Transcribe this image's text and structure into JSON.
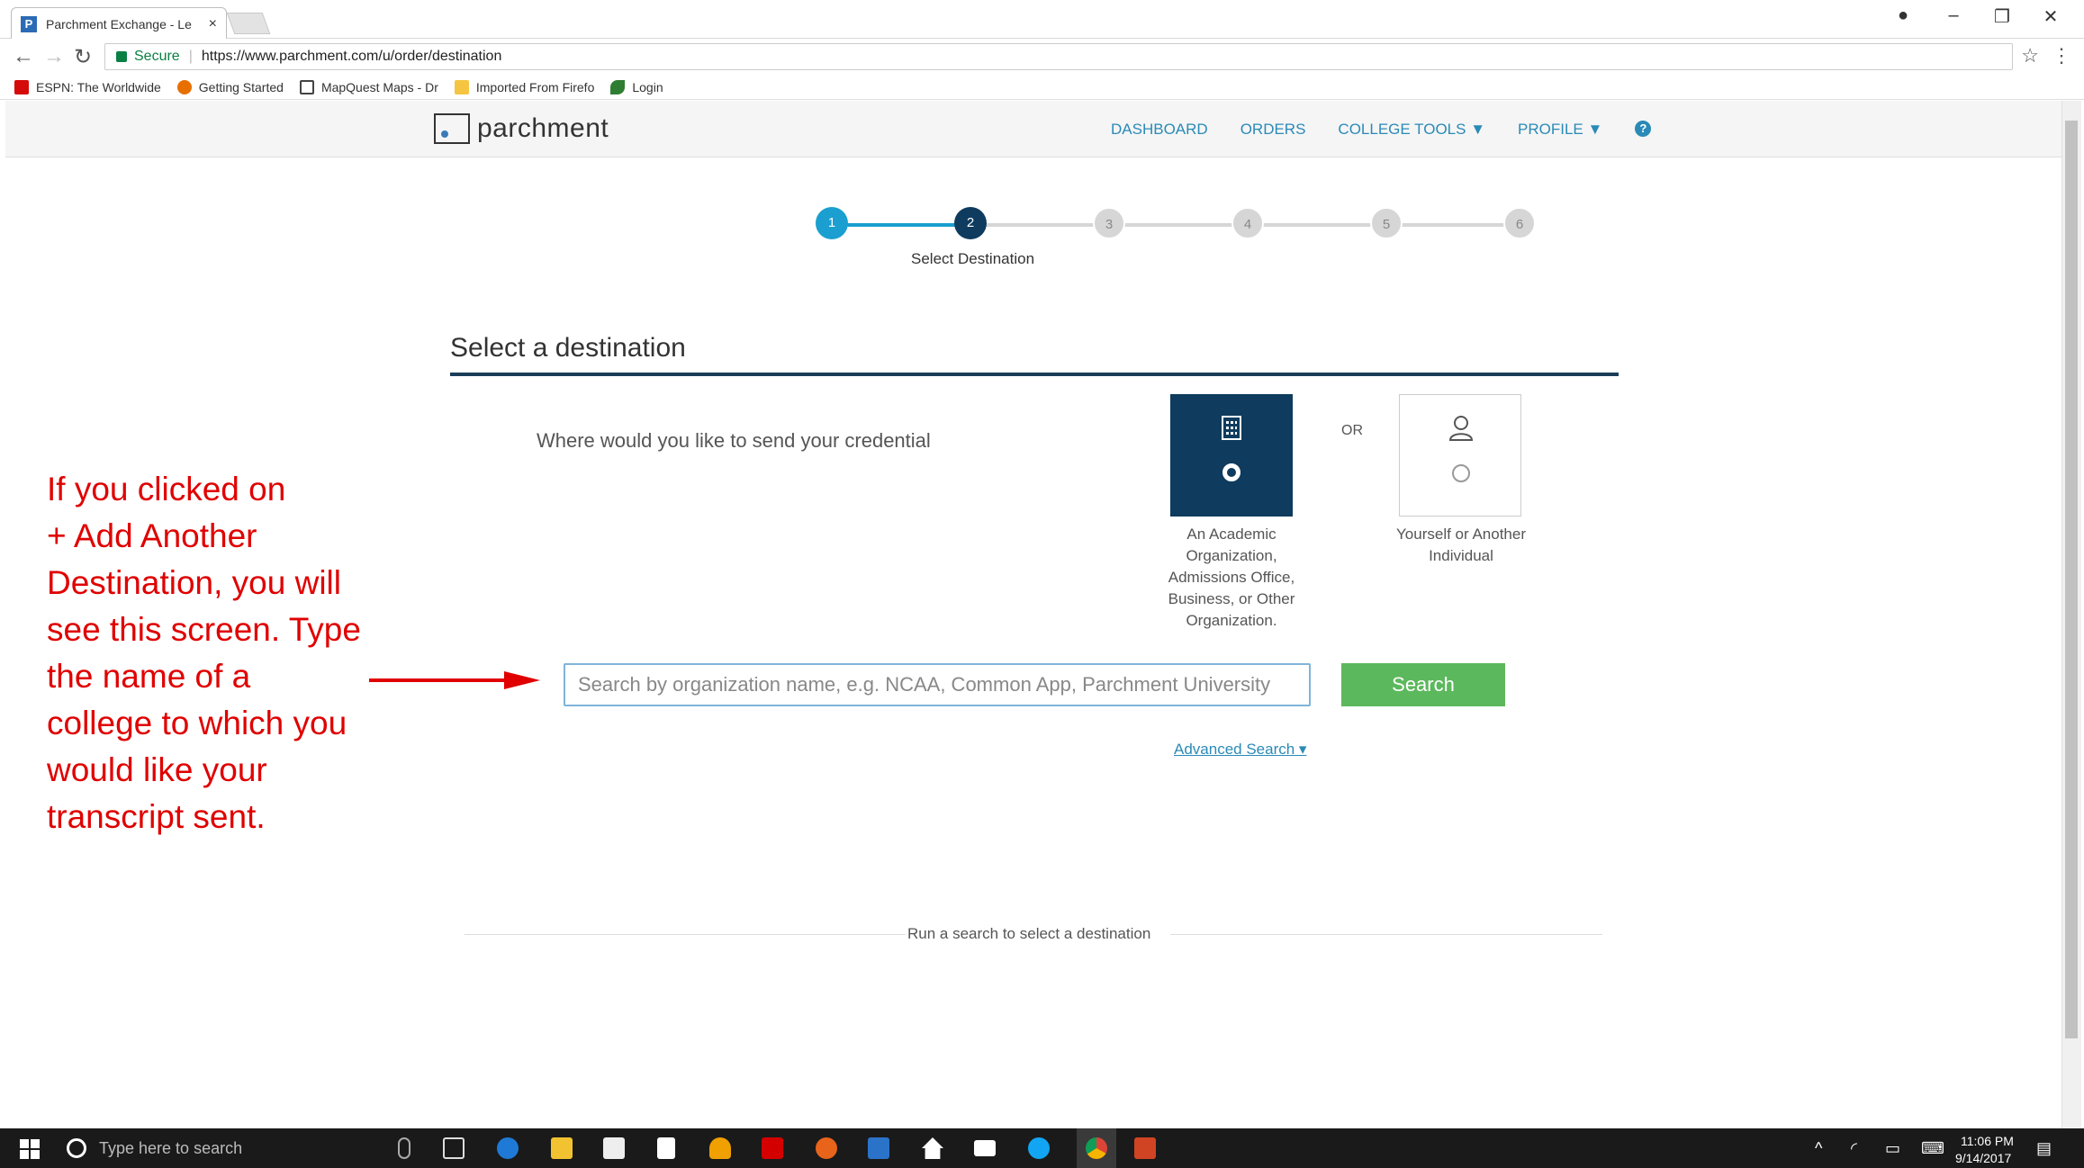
{
  "browser": {
    "tab_title": "Parchment Exchange - Le",
    "tab_close": "×",
    "secure_label": "Secure",
    "url": "https://www.parchment.com/u/order/destination",
    "bookmarks": [
      {
        "label": "ESPN: The Worldwide",
        "color": "#d50a0a"
      },
      {
        "label": "Getting Started",
        "color": "#e76f00"
      },
      {
        "label": "MapQuest Maps - Dr",
        "color": "#444444"
      },
      {
        "label": "Imported From Firefo",
        "color": "#f5c542"
      },
      {
        "label": "Login",
        "color": "#2f7d32"
      }
    ]
  },
  "header": {
    "logo_text": "parchment",
    "nav": {
      "dashboard": "DASHBOARD",
      "orders": "ORDERS",
      "college_tools": "COLLEGE TOOLS ▼",
      "profile": "PROFILE ▼",
      "help": "?"
    }
  },
  "stepper": {
    "steps": [
      "1",
      "2",
      "3",
      "4",
      "5",
      "6"
    ],
    "current_step": 2,
    "caption": "Select Destination",
    "colors": {
      "done": "#1a9fd0",
      "current": "#0e3b5e",
      "pending": "#d6d6d6"
    }
  },
  "main": {
    "section_title": "Select a destination",
    "question": "Where would you like to send your credential",
    "or_label": "OR",
    "choice_org": {
      "caption": "An Academic Organization, Admissions Office, Business, or Other Organization.",
      "selected": true
    },
    "choice_ind": {
      "caption": "Yourself or Another Individual",
      "selected": false
    },
    "search_placeholder": "Search by organization name, e.g. NCAA, Common App, Parchment University",
    "search_button": "Search",
    "advanced_search": "Advanced Search ▾",
    "results_text": "Run a search to select a destination"
  },
  "annotation": {
    "lines": [
      "If you clicked on",
      "+ Add Another",
      "Destination, you will",
      "see this screen. Type",
      "the name of a",
      "college to which you",
      "would like your",
      "transcript sent."
    ],
    "color": "#e00000"
  },
  "taskbar": {
    "search_placeholder": "Type here to search",
    "time": "11:06 PM",
    "date": "9/14/2017",
    "apps": [
      "microphone-icon",
      "task-view-icon",
      "edge-icon",
      "file-explorer-icon",
      "store-icon",
      "notepad-icon",
      "headphones-icon",
      "adobe-icon",
      "firefox-icon",
      "remote-desktop-icon",
      "home-icon",
      "mail-icon",
      "skype-icon",
      "chrome-icon",
      "powerpoint-icon"
    ]
  }
}
